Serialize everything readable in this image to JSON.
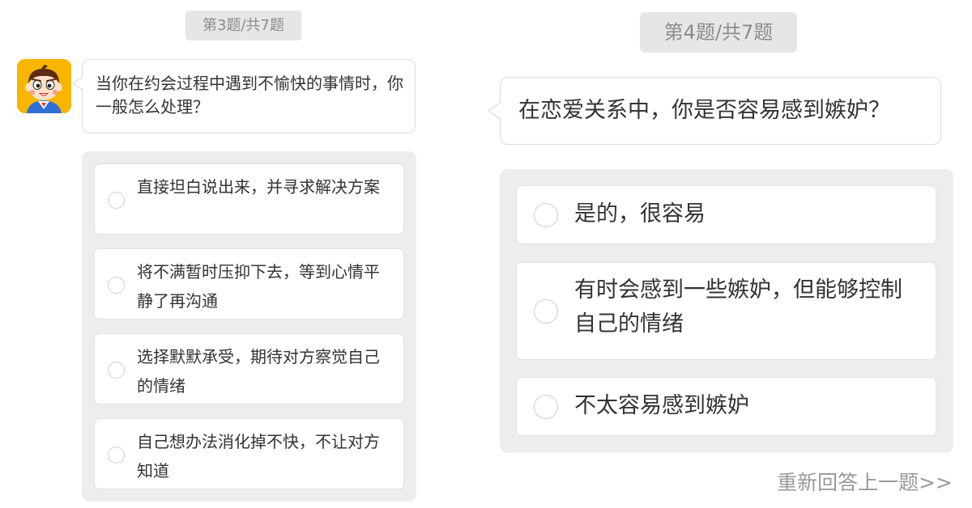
{
  "left_card": {
    "progress": "第3题/共7题",
    "question": "当你在约会过程中遇到不愉快的事情时，你一般怎么处理？",
    "options": [
      {
        "label": "直接坦白说出来，并寻求解决方案"
      },
      {
        "label": "将不满暂时压抑下去，等到心情平静了再沟通"
      },
      {
        "label": "选择默默承受，期待对方察觉自己的情绪"
      },
      {
        "label": "自己想办法消化掉不快，不让对方知道"
      }
    ]
  },
  "right_card": {
    "progress": "第4题/共7题",
    "question": "在恋爱关系中，你是否容易感到嫉妒？",
    "options": [
      {
        "label": "是的，很容易"
      },
      {
        "label": "有时会感到一些嫉妒，但能够控制自己的情绪"
      },
      {
        "label": "不太容易感到嫉妒"
      }
    ],
    "redo_link": "重新回答上一题>>"
  },
  "colors": {
    "panel_background": "#ededed",
    "progress_chip": "#e6e6e6",
    "avatar_background": "#f7b500",
    "muted_text": "#999999"
  },
  "icons": {
    "avatar": "cartoon-boy-avatar",
    "radio": "empty-radio-circle"
  }
}
